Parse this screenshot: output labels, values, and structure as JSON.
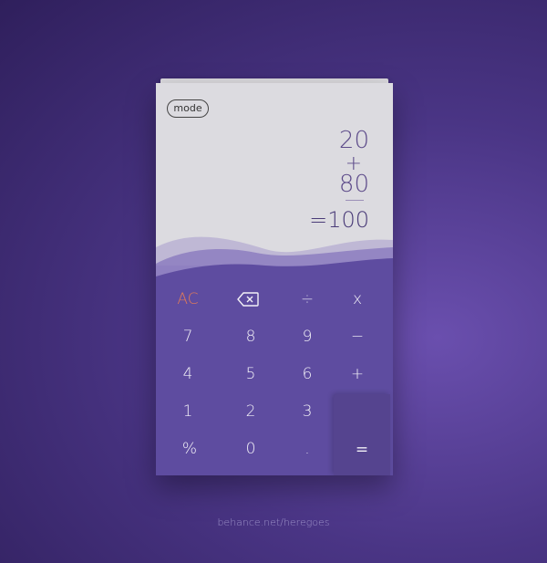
{
  "display": {
    "mode_label": "mode",
    "operand_1": "20",
    "operator": "+",
    "operand_2": "80",
    "result": "=100"
  },
  "keypad": {
    "row1": [
      "AC",
      "backspace",
      "÷",
      "x"
    ],
    "row2": [
      "7",
      "8",
      "9",
      "−"
    ],
    "row3": [
      "4",
      "5",
      "6",
      "+"
    ],
    "row4": [
      "1",
      "2",
      "3"
    ],
    "row5": [
      "%",
      "0",
      "."
    ],
    "equals": "="
  },
  "icons": {
    "backspace": "backspace-icon"
  },
  "credit": "behance.net/heregoes",
  "colors": {
    "background": "#3b2a72",
    "display": "#dcdbe0",
    "keypad": "#5e4ca0",
    "accent_ac": "#e07a5a",
    "display_text": "#5d4b8a"
  }
}
